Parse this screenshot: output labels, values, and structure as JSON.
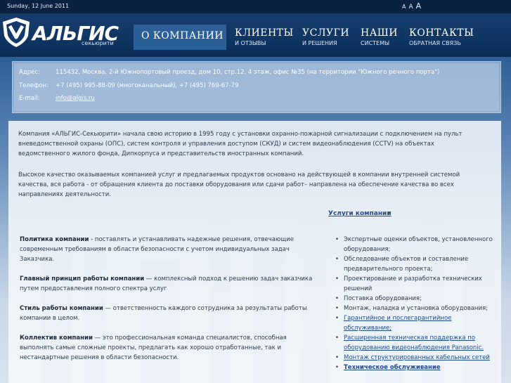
{
  "topbar": {
    "date": "Sunday, 12 June 2011",
    "font_sizes": [
      "A",
      "A",
      "A"
    ]
  },
  "logo": {
    "name": "АЛЬГИС",
    "sub": "секьюрити"
  },
  "nav": [
    {
      "l1": "О КОМПАНИИ",
      "l2": "",
      "active": true
    },
    {
      "l1": "КЛИЕНТЫ",
      "l2": "И ОТЗЫВЫ",
      "active": false
    },
    {
      "l1": "УСЛУГИ",
      "l2": "И РЕШЕНИЯ",
      "active": false
    },
    {
      "l1": "НАШИ",
      "l2": "СИСТЕМЫ",
      "active": false
    },
    {
      "l1": "КОНТАКТЫ",
      "l2": "ОБРАТНАЯ СВЯЗЬ",
      "active": false
    }
  ],
  "contact": {
    "address_label": "Адрес:",
    "address": "115432, Москва, 2-й Южнопортовый проезд, дом 10, стр.12, 4 этаж, офис №35 (на территории \"Южного речного порта\")",
    "phone_label": "Телефон:",
    "phone": "+7 (495) 995-88-09 (многоканальный), +7 (495) 769-67-79",
    "email_label": "E-mail:",
    "email": "info@algis.ru"
  },
  "content": {
    "para1": "Компания «АЛЬГИС-Секьюрити» начала свою историю в 1995 году с установки охранно-пожарной сигнализации с подключением на пульт вневедомственной охраны (ОПС), систем контроля и управления доступом (СКУД) и систем видеонаблюдения (CCTV) на объектах ведомственного жилого фонда, Дипкорпуса и представительств иностранных компаний.",
    "para2": "Высокое качество оказываемых компанией услуг и предлагаемых продуктов основано на действующей в компании внутренней системой качества, вся работа - от обращения клиента до поставки оборудования или сдачи работ– направлена на обеспечение качества во всех направлениях деятельности.",
    "services_title": "Услуги компании",
    "services_colon": ":",
    "principles": [
      {
        "bold": "Политика компании",
        "text": " - поставлять и устанавливать надежные решения, отвечающие современным требованиям в области безопасности с учетом индивидуальных задач Заказчика."
      },
      {
        "bold": "Главный принцип работы компании",
        "text": " — комплексный подход к решению задач заказчика путем предоставления полного спектра услуг"
      },
      {
        "bold": "Стиль работы компании",
        "text": " — ответственность каждого сотрудника за результаты работы компании в целом."
      },
      {
        "bold": "Коллектив компании",
        "text": " — это профессиональная команда специалистов, способная выполнять самые сложные проекты, предлагать как хорошо отработанные, так и нестандартные решения в области безопасности."
      }
    ],
    "services": [
      {
        "text": "Экспертные оценки объектов, установленного оборудования;",
        "link": false
      },
      {
        "text": "Обследование объектов и составление предварительного проекта;",
        "link": false
      },
      {
        "text": "Проектирование и разработка технических решений",
        "link": false
      },
      {
        "text": "Поставка оборудования;",
        "link": false
      },
      {
        "text": "Монтаж, наладка и установка оборудования;",
        "link": false
      },
      {
        "text": "Гарантийное и послегарантийное обслуживание;",
        "link": true
      },
      {
        "text": "Расширенная техническая поддержка по оборудованию видеонаблюдения Panasonic.",
        "link": true
      },
      {
        "text": "Монтаж структурированных кабельных сетей",
        "link": true
      },
      {
        "text": "Техническое обслуживание",
        "link": true
      }
    ]
  },
  "colors": {
    "header_bg": "#0f3563",
    "nav_active": "#2a5f97",
    "link": "#1f4a96"
  }
}
